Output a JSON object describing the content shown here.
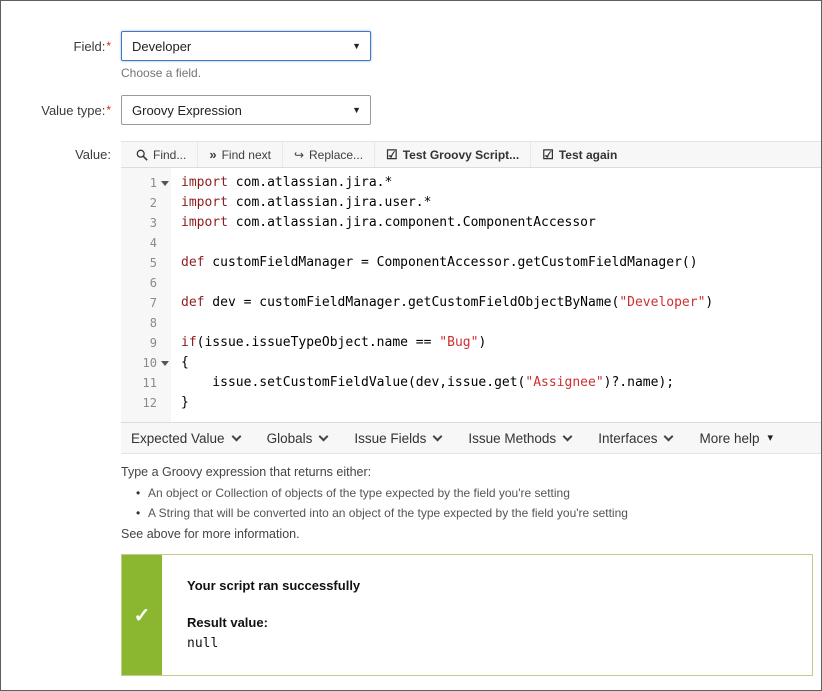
{
  "colors": {
    "accent_green": "#8bb62f",
    "keyword": "#8f1d1d",
    "string": "#cf2f2f",
    "required": "#cc2a2a",
    "focused_border": "#3f78c3"
  },
  "form": {
    "field": {
      "label": "Field:",
      "required": "*",
      "value": "Developer",
      "help": "Choose a field."
    },
    "value_type": {
      "label": "Value type:",
      "required": "*",
      "value": "Groovy Expression"
    },
    "value": {
      "label": "Value:"
    }
  },
  "editor": {
    "toolbar": [
      {
        "name": "find-button",
        "icon": "search-icon",
        "label": "Find..."
      },
      {
        "name": "find-next-button",
        "icon": "find-next-icon",
        "label": "Find next"
      },
      {
        "name": "replace-button",
        "icon": "replace-icon",
        "label": "Replace..."
      },
      {
        "name": "test-groovy-script-button",
        "icon": "test-script-icon",
        "label": "Test Groovy Script..."
      },
      {
        "name": "test-again-button",
        "icon": "test-again-icon",
        "label": "Test again"
      }
    ],
    "lines": [
      {
        "n": "1",
        "fold": true,
        "t": [
          [
            "k",
            "import"
          ],
          [
            "p",
            " com.atlassian.jira.*"
          ]
        ]
      },
      {
        "n": "2",
        "t": [
          [
            "k",
            "import"
          ],
          [
            "p",
            " com.atlassian.jira.user.*"
          ]
        ]
      },
      {
        "n": "3",
        "t": [
          [
            "k",
            "import"
          ],
          [
            "p",
            " com.atlassian.jira.component.ComponentAccessor"
          ]
        ]
      },
      {
        "n": "4",
        "t": []
      },
      {
        "n": "5",
        "t": [
          [
            "k",
            "def"
          ],
          [
            "p",
            " customFieldManager = ComponentAccessor.getCustomFieldManager()"
          ]
        ]
      },
      {
        "n": "6",
        "t": []
      },
      {
        "n": "7",
        "t": [
          [
            "k",
            "def"
          ],
          [
            "p",
            " dev = customFieldManager.getCustomFieldObjectByName("
          ],
          [
            "s",
            "\"Developer\""
          ],
          [
            "p",
            ")"
          ]
        ]
      },
      {
        "n": "8",
        "t": []
      },
      {
        "n": "9",
        "t": [
          [
            "k",
            "if"
          ],
          [
            "p",
            "(issue.issueTypeObject.name == "
          ],
          [
            "s",
            "\"Bug\""
          ],
          [
            "p",
            ")"
          ]
        ]
      },
      {
        "n": "10",
        "fold": true,
        "t": [
          [
            "p",
            "{"
          ]
        ]
      },
      {
        "n": "11",
        "t": [
          [
            "p",
            "    issue.setCustomFieldValue(dev,issue.get("
          ],
          [
            "s",
            "\"Assignee\""
          ],
          [
            "p",
            ")?.name);"
          ]
        ]
      },
      {
        "n": "12",
        "t": [
          [
            "p",
            "}"
          ]
        ]
      }
    ],
    "footer_menus": [
      {
        "label": "Expected Value",
        "caret": "chevron"
      },
      {
        "label": "Globals",
        "caret": "chevron"
      },
      {
        "label": "Issue Fields",
        "caret": "chevron"
      },
      {
        "label": "Issue Methods",
        "caret": "chevron"
      },
      {
        "label": "Interfaces",
        "caret": "chevron"
      },
      {
        "label": "More help",
        "caret": "triangle"
      }
    ]
  },
  "help": {
    "intro": "Type a Groovy expression that returns either:",
    "bullets": [
      "An object or Collection of objects of the type expected by the field you're setting",
      "A String that will be converted into an object of the type expected by the field you're setting"
    ],
    "outro": "See above for more information."
  },
  "result": {
    "title": "Your script ran successfully",
    "label": "Result value:",
    "value": "null",
    "check": "✓"
  }
}
